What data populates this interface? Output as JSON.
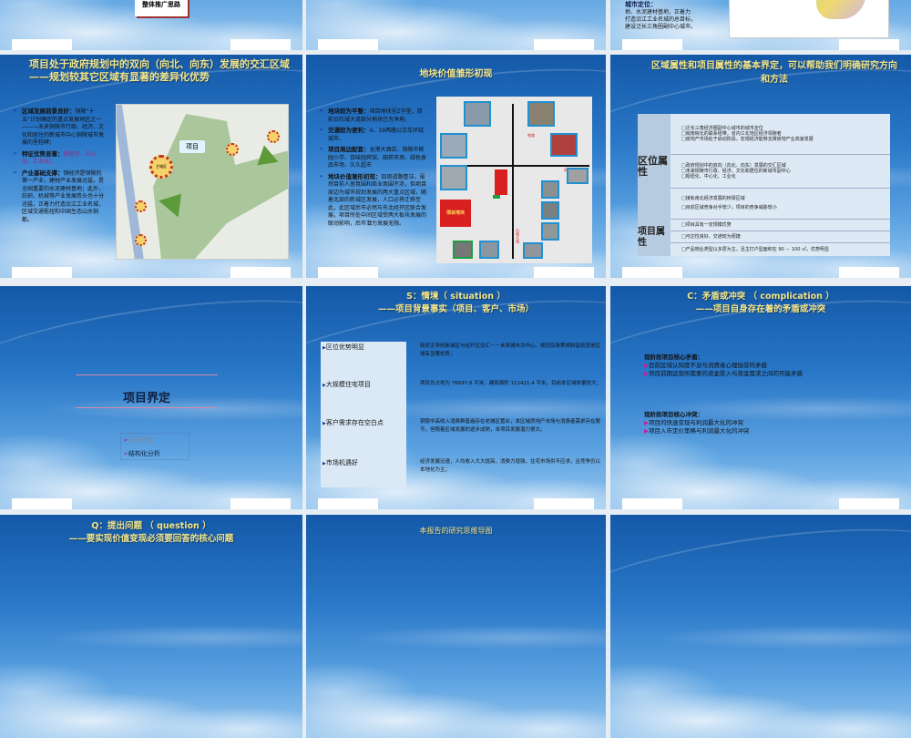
{
  "row0": {
    "s1_box": "整体推广思路",
    "s3_text": [
      "城市定位：",
      "地、水泥建材基地，正着力",
      "打造沿江工业名城的总目标，",
      "建设泛长三角圈副中心城市。"
    ]
  },
  "slide_map": {
    "title": "项目处于政府规划中的双向（向北、向东）发展的交汇区域——规划较其它区域有显著的差异化优势",
    "bullets": [
      {
        "head": "区域发展前景良好：",
        "body": "铜陵“十五”计划确定的重点发展地区之一———未来铜陵市行政、经济、文化和居住的新城市中心铜陵城市发展的里程碑；"
      },
      {
        "head": "特征优势显著：",
        "body": "枢纽化、中心化、工业化；"
      },
      {
        "head": "产业基础支撑：",
        "body": "铜经济是铜陵的第一产业，建材产业发展迅猛，是全国重要的水泥建材基地；此外，纺织、机械等产业发展势头也十分迅猛，正着力打造沿江工业名城，区域交通枢纽和中国生态山水铜都。"
      }
    ],
    "map_label": "项目",
    "map_center": "主城区"
  },
  "slide_plot": {
    "title": "地块价值雏形初现",
    "bullets": [
      {
        "head": "地块较为平整：",
        "body": "项目地块呈Z字型，目前沿石城大道部分地块已为净地。"
      },
      {
        "head": "交通较为便利：",
        "body": "4、19两路公交车环绕城市。"
      },
      {
        "head": "项目周边配套：",
        "body": "龙港大酒店、铜陵市柳园小学、百味园宾馆、田苑市场、绿色食品市场、久久超市"
      },
      {
        "head": "地块价值雏形初现：",
        "body": "四周道路整洁，虽然目前人居氛围和商业氛围不浓，但项目周边为城市规划发展的两大重点区域，随着北部的新城区发展，人口必将迁移至此，此区域后市必然与东北经开区联合发展，项目所处中间区域受两大板块发展的联动影响，后市潜力发展无限。"
      }
    ],
    "plot_label": "项目地块",
    "road1": "铁路",
    "road2": "铜官路",
    "road3": "石城大道"
  },
  "slide_attr": {
    "title": "区域属性和项目属性的基本界定，可以帮助我们明确研究方向和方法",
    "groups": [
      {
        "label": "区位属性",
        "rows": [
          [
            "□泛长三角经济圈副中心城市的城市定位",
            "□皖南皖北的联系纽带，省内江北地区经济领跑者",
            "□房地产市场处于启动阶段，宏观经济能够支撑房地产业高速发展"
          ],
          [
            "□政府规划中的双向（向北、向东）发展的交汇区域",
            "□未来铜陵市行政、经济、文化和居住的新城市副中心",
            "□枢纽化、中心化、工业化"
          ],
          [
            "□接轨南北经济发展的桥梁区域",
            "□目前区域竞争对手较少，项目的竞争威胁较小"
          ]
        ]
      },
      {
        "label": "项目属性",
        "rows": [
          [
            "□项目具有一定规模优势"
          ],
          [
            "□可达性良好、交通较为便捷"
          ],
          [
            "□产品物业类型以多层为主，且主打户型面积在 90 － 100 ㎡，优势明显"
          ]
        ]
      }
    ]
  },
  "slide_section": {
    "title": "项目界定",
    "items": [
      "问题界定",
      "结构化分析"
    ]
  },
  "slide_situation": {
    "title1": "S：情境（ situation ）",
    "title2": "——项目背景事实（项目、客户、市场）",
    "items": [
      {
        "label": "区位优势明显",
        "text": "政府主导的新城区与经开区交汇－－未来城市次中心，规划及政策倾斜皆较其他区域有显著优势；"
      },
      {
        "label": "大规模住宅项目",
        "text": "项目总占地为 76697.6 平米，建筑面积 111421.4 平米，目前本区域体量较大；"
      },
      {
        "label": "客户需求存在空白点",
        "text": "铜陵中高收入消费群普遍存在老城区置业，本区域房地产市场与消费者需求存在脱节，但随着区域发展的逐步成熟，本项目发展潜力很大。"
      },
      {
        "label": "市场机遇好",
        "text": "经济发展迅速，人均收入大大提高，消费力增强，住宅市场供不应求，且竞争仍以本地化为主；"
      }
    ]
  },
  "slide_complication": {
    "title1": "C：矛盾或冲突 （ complication ）",
    "title2": "——项目自身存在着的矛盾或冲突",
    "groups": [
      {
        "head": "现阶段项目核心矛盾：",
        "items": [
          "目前区域认知度不足与消费者心理接受的矛盾",
          "项目前期运营所需要的资金投入与资金需求之间的可能矛盾"
        ]
      },
      {
        "head": "现阶段项目核心冲突：",
        "items": [
          "项目的快速变现与利润最大化的冲突",
          "项目入市定价策略与利润最大化的冲突"
        ]
      }
    ]
  },
  "row3": {
    "q_title1": "Q：提出问题 （ question ）",
    "q_title2": "——要实现价值变现必须要回答的核心问题",
    "mindmap_title": "本报告的研究思维导图"
  }
}
